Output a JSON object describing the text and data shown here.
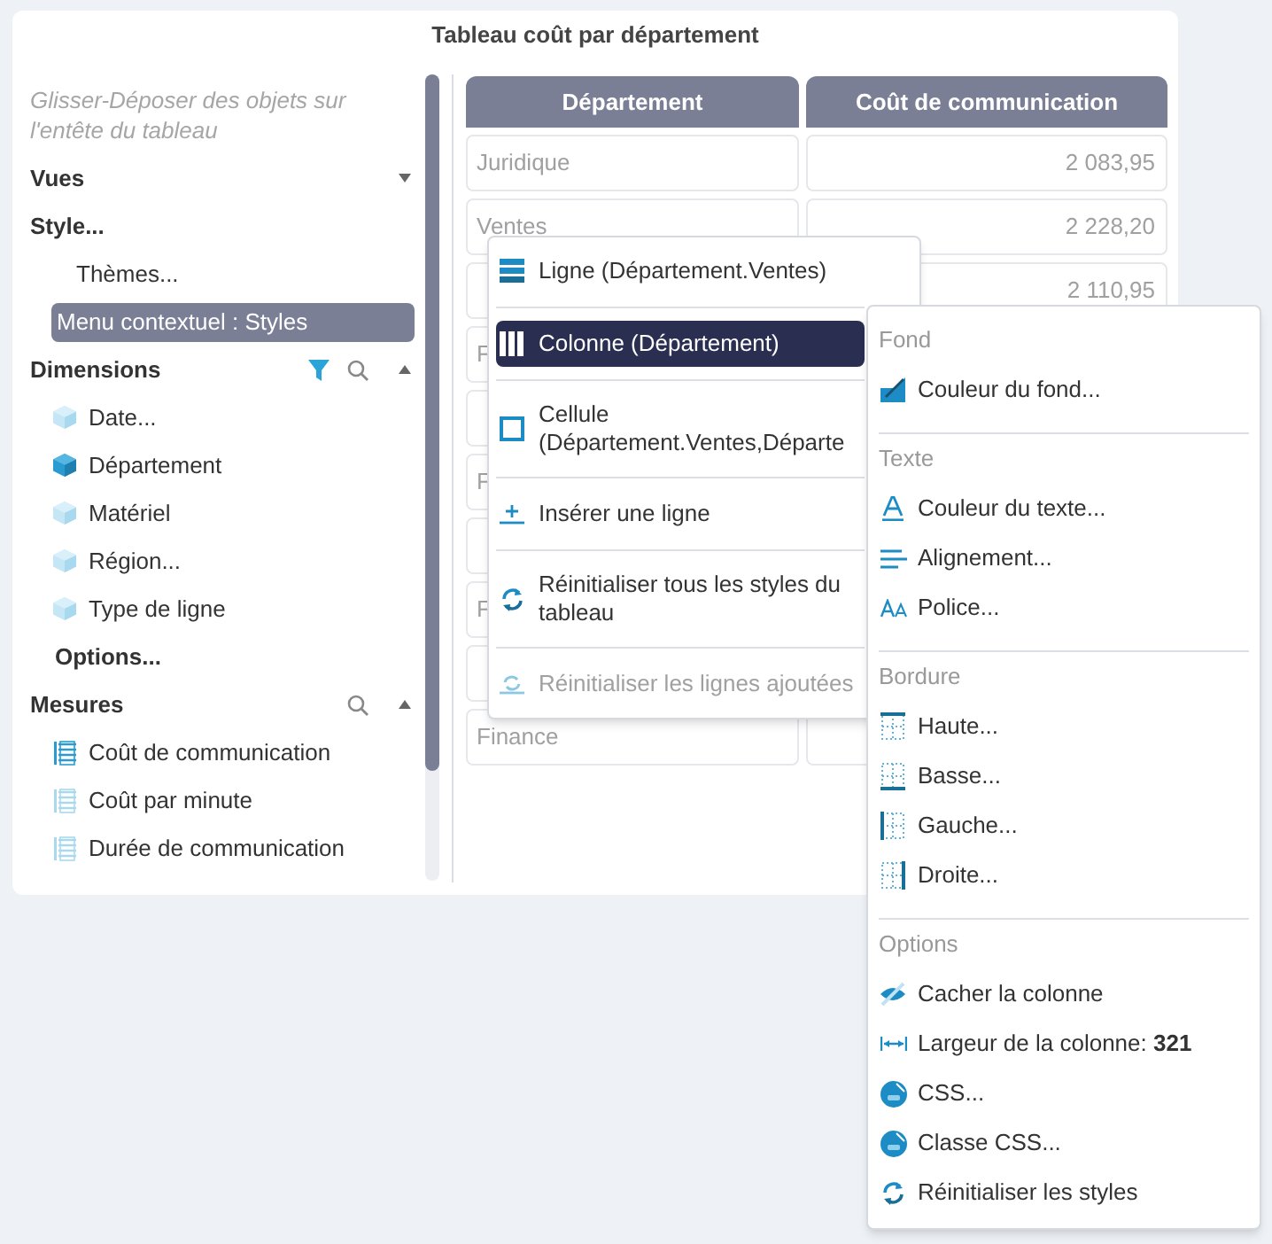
{
  "title": "Tableau coût par département",
  "sidebar": {
    "hint": "Glisser-Déposer des objets sur l'entête du tableau",
    "items": [
      {
        "kind": "section",
        "label": "Vues",
        "expanded": false,
        "filter": false,
        "search": false
      },
      {
        "kind": "heading",
        "label": "Style..."
      },
      {
        "kind": "sub",
        "label": "Thèmes...",
        "selected": false
      },
      {
        "kind": "sub",
        "label": "Menu contextuel : Styles",
        "selected": true
      },
      {
        "kind": "section",
        "label": "Dimensions",
        "expanded": true,
        "filter": true,
        "search": true
      },
      {
        "kind": "dimension",
        "label": "Date...",
        "used": false
      },
      {
        "kind": "dimension",
        "label": "Département",
        "used": true
      },
      {
        "kind": "dimension",
        "label": "Matériel",
        "used": false
      },
      {
        "kind": "dimension",
        "label": "Région...",
        "used": false
      },
      {
        "kind": "dimension",
        "label": "Type de ligne",
        "used": false
      },
      {
        "kind": "option",
        "label": "Options..."
      },
      {
        "kind": "section",
        "label": "Mesures",
        "expanded": true,
        "filter": false,
        "search": true
      },
      {
        "kind": "measure",
        "label": "Coût de communication",
        "used": true
      },
      {
        "kind": "measure",
        "label": "Coût par minute",
        "used": false
      },
      {
        "kind": "measure",
        "label": "Durée de communication",
        "used": false
      }
    ]
  },
  "table": {
    "columns": [
      "Département",
      "Coût de communication"
    ],
    "rows": [
      {
        "cells": [
          "Juridique",
          "2 083,95"
        ]
      },
      {
        "cells": [
          "Ventes",
          "2 228,20"
        ]
      },
      {
        "cells": [
          "",
          "2 110,95"
        ]
      },
      {
        "cells": [
          "F"
        ]
      },
      {},
      {
        "cells": [
          "F"
        ]
      },
      {},
      {
        "cells": [
          "F"
        ]
      },
      {},
      {
        "cells": [
          "Finance"
        ]
      }
    ]
  },
  "context_menu": {
    "items": [
      {
        "label": "Ligne (Département.Ventes)",
        "selected": false,
        "disabled": false
      },
      {
        "label": "Colonne (Département)",
        "selected": true,
        "disabled": false
      },
      {
        "label": "Cellule (Département.Ventes,Départe",
        "selected": false,
        "disabled": false
      },
      {
        "label": "Insérer une ligne",
        "selected": false,
        "disabled": false
      },
      {
        "label": "Réinitialiser tous les styles du tableau",
        "selected": false,
        "disabled": false
      },
      {
        "label": "Réinitialiser les lignes ajoutées",
        "selected": false,
        "disabled": true
      }
    ]
  },
  "style_menu": {
    "groups": [
      {
        "title": "Fond",
        "items": [
          {
            "label": "Couleur du fond..."
          }
        ]
      },
      {
        "title": "Texte",
        "items": [
          {
            "label": "Couleur du texte..."
          },
          {
            "label": "Alignement..."
          },
          {
            "label": "Police..."
          }
        ]
      },
      {
        "title": "Bordure",
        "items": [
          {
            "label": "Haute..."
          },
          {
            "label": "Basse..."
          },
          {
            "label": "Gauche..."
          },
          {
            "label": "Droite..."
          }
        ]
      },
      {
        "title": "Options",
        "items": [
          {
            "label": "Cacher la colonne"
          },
          {
            "label": "Largeur de la colonne: **321**"
          },
          {
            "label": "CSS..."
          },
          {
            "label": "Classe CSS..."
          },
          {
            "label": "Réinitialiser les styles"
          }
        ]
      }
    ]
  }
}
